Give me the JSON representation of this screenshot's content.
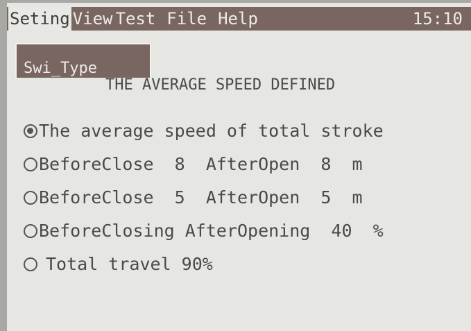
{
  "menu": {
    "items": [
      "Seting",
      "View",
      "Test",
      "File",
      "Help"
    ],
    "clock": "15:10"
  },
  "tab": {
    "label": "Swi_Type"
  },
  "title": "THE AVERAGE SPEED DEFINED",
  "options": [
    {
      "label": "The average speed of total stroke",
      "selected": true
    },
    {
      "label": "BeforeClose  8  AfterOpen  8  m",
      "selected": false
    },
    {
      "label": "BeforeClose  5  AfterOpen  5  m",
      "selected": false
    },
    {
      "label": "BeforeClosing AfterOpening  40  %",
      "selected": false
    },
    {
      "label": "Total travel 90%",
      "selected": false
    }
  ]
}
